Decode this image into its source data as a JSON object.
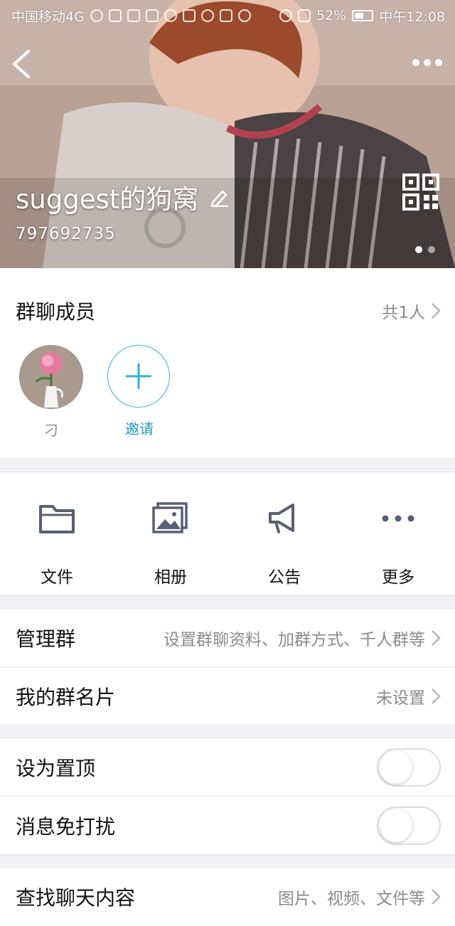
{
  "status_bar": {
    "carrier": "中国移动4G",
    "battery": "52%",
    "time": "中午12:08"
  },
  "header": {
    "group_name": "suggest的狗窝",
    "group_id": "797692735"
  },
  "members": {
    "title": "群聊成员",
    "count_label": "共1人",
    "list": [
      {
        "name": "刁"
      }
    ],
    "invite_label": "邀请"
  },
  "actions": [
    {
      "label": "文件",
      "icon": "folder-icon"
    },
    {
      "label": "相册",
      "icon": "photo-album-icon"
    },
    {
      "label": "公告",
      "icon": "megaphone-icon"
    },
    {
      "label": "更多",
      "icon": "more-dots-icon"
    }
  ],
  "settings": {
    "manage": {
      "title": "管理群",
      "detail": "设置群聊资料、加群方式、千人群等"
    },
    "card": {
      "title": "我的群名片",
      "detail": "未设置"
    },
    "pin": {
      "title": "设为置顶",
      "enabled": false
    },
    "mute": {
      "title": "消息免打扰",
      "enabled": false
    },
    "search": {
      "title": "查找聊天内容",
      "detail": "图片、视频、文件等"
    }
  },
  "colors": {
    "accent": "#2fb3d9",
    "invite_text": "#2199c8",
    "secondary_text": "#8a8a8f",
    "icon": "#5a5f73"
  }
}
